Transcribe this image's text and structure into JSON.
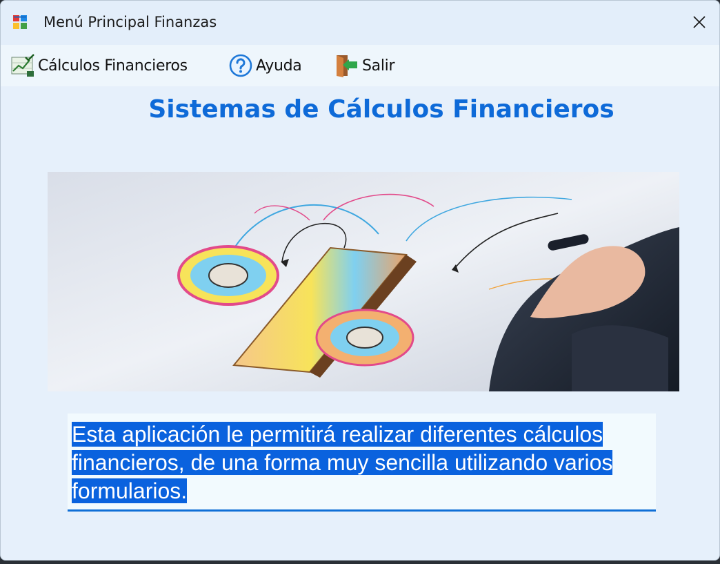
{
  "window": {
    "title": "Menú Principal Finanzas",
    "icon": "windows-forms-app-icon",
    "close_icon": "close-icon"
  },
  "menu": {
    "items": [
      {
        "label": "Cálculos Financieros",
        "icon": "chart-check-icon"
      },
      {
        "label": "Ayuda",
        "icon": "help-circle-icon"
      },
      {
        "label": "Salir",
        "icon": "exit-door-icon"
      }
    ]
  },
  "main": {
    "heading": "Sistemas de Cálculos Financieros",
    "banner_image": "percent-sign-sketch-illustration",
    "description": "Esta aplicación le permitirá realizar diferentes cálculos financieros, de una forma muy sencilla utilizando varios formularios."
  },
  "colors": {
    "accent": "#0e6ad8",
    "selection": "#0a62de",
    "window_bg": "#e6f0fb",
    "menubar_bg": "#eef6fc"
  }
}
